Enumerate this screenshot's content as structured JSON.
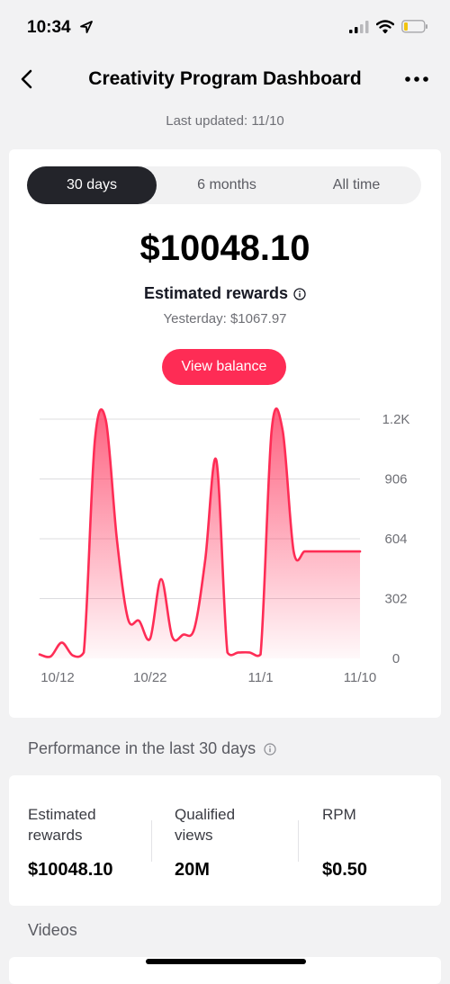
{
  "status_bar": {
    "time": "10:34",
    "battery_level": 0.15
  },
  "header": {
    "title": "Creativity Program Dashboard",
    "last_updated": "Last updated: 11/10"
  },
  "tabs": [
    "30 days",
    "6 months",
    "All time"
  ],
  "summary": {
    "amount": "$10048.10",
    "label": "Estimated rewards",
    "yesterday": "Yesterday: $1067.97",
    "view_balance": "View balance"
  },
  "chart_data": {
    "type": "area",
    "x": [
      "10/12",
      "10/13",
      "10/14",
      "10/15",
      "10/16",
      "10/17",
      "10/18",
      "10/19",
      "10/20",
      "10/21",
      "10/22",
      "10/23",
      "10/24",
      "10/25",
      "10/26",
      "10/27",
      "10/28",
      "10/29",
      "10/30",
      "10/31",
      "11/1",
      "11/2",
      "11/3",
      "11/4",
      "11/5",
      "11/6",
      "11/7",
      "11/8",
      "11/9",
      "11/10"
    ],
    "values": [
      20,
      10,
      80,
      15,
      30,
      1100,
      1200,
      600,
      200,
      190,
      100,
      400,
      110,
      120,
      150,
      500,
      1000,
      30,
      30,
      30,
      20,
      1150,
      1150,
      540,
      540,
      540,
      540,
      540,
      540,
      540
    ],
    "xticks": [
      "10/12",
      "10/22",
      "11/1",
      "11/10"
    ],
    "yticks": [
      "0",
      "302",
      "604",
      "906",
      "1.2K"
    ],
    "ylim": [
      0,
      1208
    ],
    "y_axis_position": "right",
    "grid": true,
    "line_color": "#fe2c55"
  },
  "performance": {
    "title": "Performance in the last 30 days",
    "metrics": [
      {
        "label_line1": "Estimated",
        "label_line2": "rewards",
        "value": "$10048.10"
      },
      {
        "label_line1": "Qualified",
        "label_line2": "views",
        "value": "20M"
      },
      {
        "label_line1": "RPM",
        "label_line2": "",
        "value": "$0.50"
      }
    ]
  },
  "videos": {
    "title": "Videos"
  }
}
